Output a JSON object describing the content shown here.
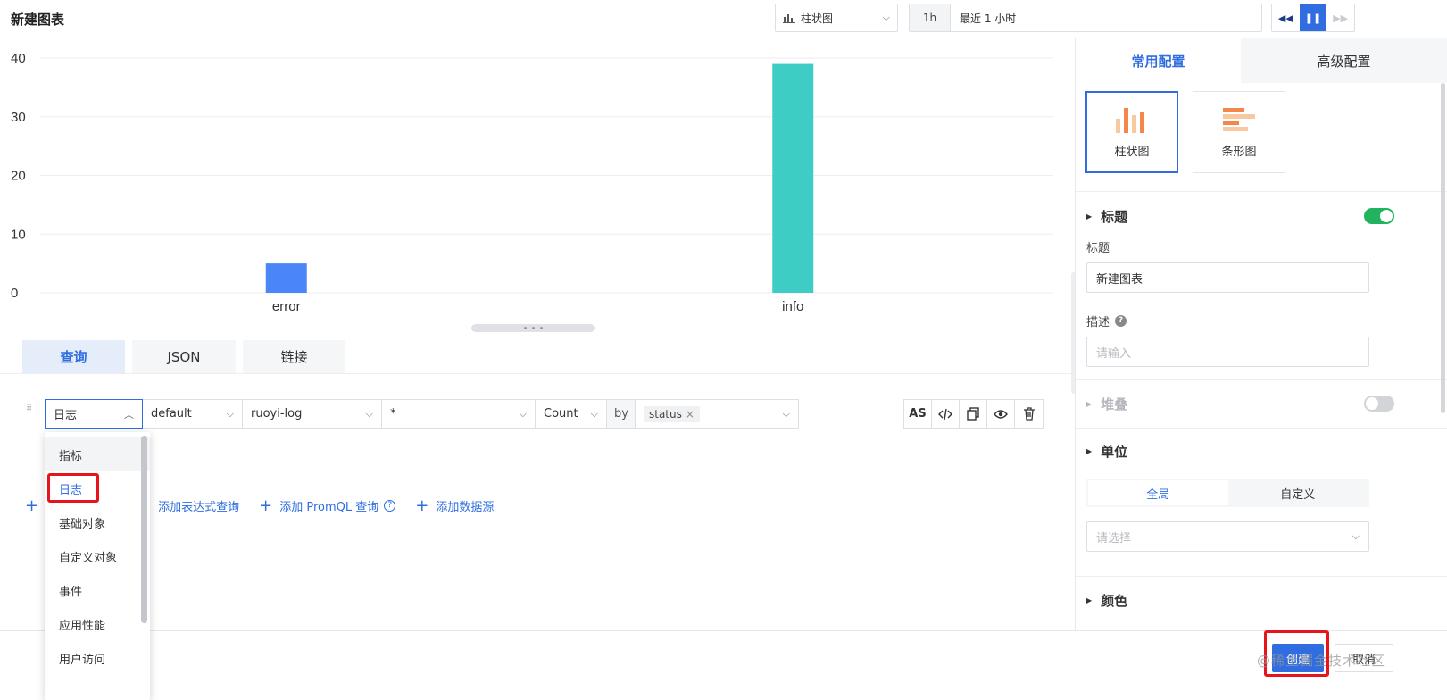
{
  "header": {
    "title": "新建图表",
    "chart_type": "柱状图",
    "time_short": "1h",
    "time_long": "最近 1 小时"
  },
  "chart_data": {
    "type": "bar",
    "categories": [
      "error",
      "info"
    ],
    "values": [
      5,
      39
    ],
    "colors": [
      "#4a86f7",
      "#3ecdc4"
    ],
    "yticks": [
      0,
      10,
      20,
      30,
      40
    ],
    "ylim": [
      0,
      40
    ],
    "grid": true
  },
  "query_tabs": [
    "查询",
    "JSON",
    "链接"
  ],
  "query": {
    "type": "日志",
    "namespace": "default",
    "source": "ruoyi-log",
    "filter": "*",
    "agg": "Count",
    "by_label": "by",
    "group_tag": "status",
    "tag_remove": "×"
  },
  "actions": {
    "alias": "AS",
    "code_icon": "code-icon",
    "copy_icon": "copy-icon",
    "eye_icon": "eye-icon",
    "trash_icon": "trash-icon"
  },
  "add_links": {
    "expr": "添加表达式查询",
    "promql": "添加 PromQL 查询",
    "datasource": "添加数据源"
  },
  "dropdown": {
    "items": [
      "指标",
      "日志",
      "基础对象",
      "自定义对象",
      "事件",
      "应用性能",
      "用户访问"
    ],
    "selected": 1
  },
  "right_panel": {
    "tabs": [
      "常用配置",
      "高级配置"
    ],
    "viz_cards": [
      "柱状图",
      "条形图"
    ],
    "title_section": {
      "heading": "标题",
      "label": "标题",
      "value": "新建图表",
      "desc_label": "描述",
      "desc_placeholder": "请输入"
    },
    "stack_heading": "堆叠",
    "unit_section": {
      "heading": "单位",
      "options": [
        "全局",
        "自定义"
      ],
      "select_placeholder": "请选择"
    },
    "color_heading": "颜色"
  },
  "buttons": {
    "create": "创建",
    "cancel": "取消"
  },
  "watermark": "@稀土掘金技术社区",
  "colors": {
    "primary": "#2f6de1",
    "toggle_on": "#22b35e",
    "highlight": "#e8141b"
  }
}
